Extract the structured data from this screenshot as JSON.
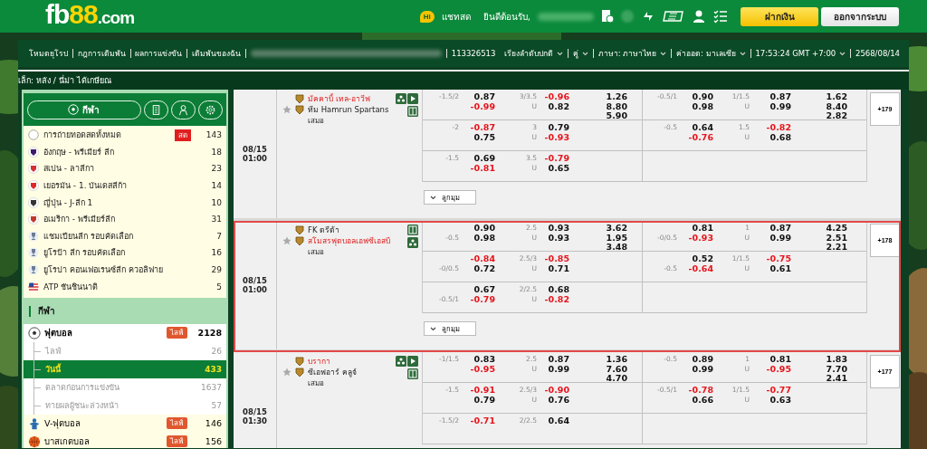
{
  "header": {
    "logo": {
      "main": "fb",
      "accent": "88",
      "suffix": ".com"
    },
    "chat_badge": "Hi",
    "chat_label": "แชทสด",
    "welcome": "ยินดีต้อนรับ,",
    "deposit_button": "ฝากเงิน",
    "logout_button": "ออกจากระบบ"
  },
  "nav": {
    "links": [
      "โหมดยุโรป",
      "กฎการเดิมพัน",
      "ผลการแข่งขัน",
      "เดิมพันของฉัน"
    ],
    "account_id": "113326513",
    "dropdowns": [
      "เรียงลำดับปกติ",
      "คู่",
      "ภาษา: ภาษาไทย",
      "ค่าออด: มาเลเซีย",
      "17:53:24 GMT +7:00"
    ],
    "date": "2568/08/14"
  },
  "breadcrumb": "เล็ก: หลัง / นี่ม่า ได้เกษียณ",
  "sidebar": {
    "sports_button": "กีฬา",
    "leagues": [
      {
        "kind": "all",
        "name": "การถ่ายทอดสดทั้งหมด",
        "badge": "สด",
        "count": "143"
      },
      {
        "kind": "crest",
        "color": "#3d1a6e",
        "name": "อังกฤษ - พรีเมียร์ ลีก",
        "count": "18"
      },
      {
        "kind": "crest",
        "color": "#d63030",
        "name": "สเปน - ลาลีกา",
        "count": "23"
      },
      {
        "kind": "crest",
        "color": "#e02828",
        "name": "เยอรมัน - 1. บันเดสลีก้า",
        "count": "14"
      },
      {
        "kind": "crest",
        "color": "#333333",
        "name": "ญี่ปุ่น - J-ลีก 1",
        "count": "10"
      },
      {
        "kind": "crest",
        "color": "#c0392b",
        "name": "อเมริกา - พรีเมียร์ลีก",
        "count": "31"
      },
      {
        "kind": "trophy",
        "name": "แชมเปียนลีก รอบคัดเลือก",
        "count": "7"
      },
      {
        "kind": "trophy",
        "name": "ยูโรป้า ลีก รอบคัดเลือก",
        "count": "16"
      },
      {
        "kind": "trophy",
        "name": "ยูโรปา คอนเฟอเรนซ์ลีก ควอลิฟาย",
        "count": "29"
      },
      {
        "kind": "flag",
        "name": "ATP ชันชินนาติ",
        "count": "5"
      }
    ],
    "section_title": "กีฬา",
    "sports": [
      {
        "kind": "football",
        "name": "ฟุตบอล",
        "badge": "ไลฟ์",
        "count": "2128",
        "expanded": true,
        "children": [
          {
            "name": "ไลฟ์",
            "count": "26",
            "selected": false
          },
          {
            "name": "วันนี้",
            "count": "433",
            "selected": true
          },
          {
            "name": "ตลาดก่อนการแข่งขัน",
            "count": "1637",
            "selected": false
          },
          {
            "name": "ทายผลผู้ชนะล่วงหน้า",
            "count": "57",
            "selected": false
          }
        ]
      },
      {
        "kind": "virtual",
        "name": "V-ฟุตบอล",
        "badge": "ไลฟ์",
        "count": "146",
        "expanded": false
      },
      {
        "kind": "basketball",
        "name": "บาสเกตบอล",
        "badge": "ไลฟ์",
        "count": "156",
        "expanded": false
      }
    ]
  },
  "matches": [
    {
      "date": "08/15",
      "time": "01:00",
      "home": "มัคคาบี้ เทล-อาวีฟ",
      "away": "ทีม Hamrun Spartans",
      "draw": "เสมอ",
      "home_favorite": true,
      "highlighted": false,
      "icon_rows": [
        [
          {
            "kind": "stats"
          },
          {
            "kind": "play"
          }
        ],
        [
          {
            "kind": "field"
          }
        ]
      ],
      "more": "+179",
      "corners_button": "ลูกมุม",
      "lines": [
        {
          "ft": {
            "hdp": "-1.5/2",
            "hdp_prices": [
              {
                "v": "0.87",
                "negative": false
              },
              {
                "v": "-0.99",
                "negative": true
              }
            ],
            "ou": "3/3.5",
            "ou_under": "U",
            "ou_prices": [
              {
                "v": "-0.96",
                "negative": true
              },
              {
                "v": "0.82",
                "negative": false
              }
            ],
            "x12": [
              "1.26",
              "8.80",
              "5.90"
            ]
          },
          "ht": {
            "hdp": "-0.5/1",
            "hdp_prices": [
              {
                "v": "0.90",
                "negative": false
              },
              {
                "v": "0.98",
                "negative": false
              }
            ],
            "ou": "1/1.5",
            "ou_under": "U",
            "ou_prices": [
              {
                "v": "0.87",
                "negative": false
              },
              {
                "v": "0.99",
                "negative": false
              }
            ],
            "x12": [
              "1.62",
              "8.40",
              "2.82"
            ]
          }
        },
        {
          "ft": {
            "hdp": "-2",
            "hdp_prices": [
              {
                "v": "-0.87",
                "negative": true
              },
              {
                "v": "0.75",
                "negative": false
              }
            ],
            "ou": "3",
            "ou_under": "U",
            "ou_prices": [
              {
                "v": "0.79",
                "negative": false
              },
              {
                "v": "-0.93",
                "negative": true
              }
            ]
          },
          "ht": {
            "hdp": "-0.5",
            "hdp_prices": [
              {
                "v": "0.64",
                "negative": false
              },
              {
                "v": "-0.76",
                "negative": true
              }
            ],
            "ou": "1.5",
            "ou_under": "U",
            "ou_prices": [
              {
                "v": "-0.82",
                "negative": true
              },
              {
                "v": "0.68",
                "negative": false
              }
            ]
          }
        },
        {
          "ft": {
            "hdp": "-1.5",
            "hdp_prices": [
              {
                "v": "0.69",
                "negative": false
              },
              {
                "v": "-0.81",
                "negative": true
              }
            ],
            "ou": "3.5",
            "ou_under": "U",
            "ou_prices": [
              {
                "v": "-0.79",
                "negative": true
              },
              {
                "v": "0.65",
                "negative": false
              }
            ]
          }
        }
      ]
    },
    {
      "date": "08/15",
      "time": "01:00",
      "home": "FK ตรีต้า",
      "away": "สโมสรฟุตบอลเอฟซีเอสบี",
      "draw": "เสมอ",
      "home_favorite": false,
      "highlighted": true,
      "icon_rows": [
        [
          {
            "kind": "field"
          }
        ],
        [
          {
            "kind": "stats"
          }
        ]
      ],
      "more": "+178",
      "corners_button": "ลูกมุม",
      "lines": [
        {
          "ft": {
            "hdp": "-0.5",
            "hdp_prices": [
              {
                "v": "0.90",
                "negative": false
              },
              {
                "v": "0.98",
                "negative": false
              }
            ],
            "ou": "2.5",
            "ou_under": "U",
            "ou_prices": [
              {
                "v": "0.93",
                "negative": false
              },
              {
                "v": "0.93",
                "negative": false
              }
            ],
            "x12": [
              "3.62",
              "1.95",
              "3.48"
            ]
          },
          "ht": {
            "hdp": "-0/0.5",
            "hdp_prices": [
              {
                "v": "0.81",
                "negative": false
              },
              {
                "v": "-0.93",
                "negative": true
              }
            ],
            "ou": "1",
            "ou_under": "U",
            "ou_prices": [
              {
                "v": "0.87",
                "negative": false
              },
              {
                "v": "0.99",
                "negative": false
              }
            ],
            "x12": [
              "4.25",
              "2.51",
              "2.21"
            ]
          }
        },
        {
          "ft": {
            "hdp": "-0/0.5",
            "hdp_prices": [
              {
                "v": "-0.84",
                "negative": true
              },
              {
                "v": "0.72",
                "negative": false
              }
            ],
            "ou": "2.5/3",
            "ou_under": "U",
            "ou_prices": [
              {
                "v": "-0.85",
                "negative": true
              },
              {
                "v": "0.71",
                "negative": false
              }
            ]
          },
          "ht": {
            "hdp": "-0.5",
            "hdp_prices": [
              {
                "v": "0.52",
                "negative": false
              },
              {
                "v": "-0.64",
                "negative": true
              }
            ],
            "ou": "1/1.5",
            "ou_under": "U",
            "ou_prices": [
              {
                "v": "-0.75",
                "negative": true
              },
              {
                "v": "0.61",
                "negative": false
              }
            ]
          }
        },
        {
          "ft": {
            "hdp": "-0.5/1",
            "hdp_prices": [
              {
                "v": "0.67",
                "negative": false
              },
              {
                "v": "-0.79",
                "negative": true
              }
            ],
            "ou": "2/2.5",
            "ou_under": "U",
            "ou_prices": [
              {
                "v": "0.68",
                "negative": false
              },
              {
                "v": "-0.82",
                "negative": true
              }
            ]
          }
        }
      ]
    },
    {
      "date": "08/15",
      "time": "01:30",
      "home": "บรากา",
      "away": "ซีเอฟอาร์ คลูจ์",
      "draw": "เสมอ",
      "home_favorite": true,
      "highlighted": false,
      "icon_rows": [
        [
          {
            "kind": "stats"
          },
          {
            "kind": "play"
          }
        ],
        [
          {
            "kind": "field"
          }
        ]
      ],
      "more": "+177",
      "lines": [
        {
          "ft": {
            "hdp": "-1/1.5",
            "hdp_prices": [
              {
                "v": "0.83",
                "negative": false
              },
              {
                "v": "-0.95",
                "negative": true
              }
            ],
            "ou": "2.5",
            "ou_under": "U",
            "ou_prices": [
              {
                "v": "0.87",
                "negative": false
              },
              {
                "v": "0.99",
                "negative": false
              }
            ],
            "x12": [
              "1.36",
              "7.60",
              "4.70"
            ]
          },
          "ht": {
            "hdp": "-0.5",
            "hdp_prices": [
              {
                "v": "0.89",
                "negative": false
              },
              {
                "v": "0.99",
                "negative": false
              }
            ],
            "ou": "1",
            "ou_under": "U",
            "ou_prices": [
              {
                "v": "0.81",
                "negative": false
              },
              {
                "v": "-0.95",
                "negative": true
              }
            ],
            "x12": [
              "1.83",
              "7.70",
              "2.41"
            ]
          }
        },
        {
          "ft": {
            "hdp": "-1.5",
            "hdp_prices": [
              {
                "v": "-0.91",
                "negative": true
              },
              {
                "v": "0.79",
                "negative": false
              }
            ],
            "ou": "2.5/3",
            "ou_under": "U",
            "ou_prices": [
              {
                "v": "-0.90",
                "negative": true
              },
              {
                "v": "0.76",
                "negative": false
              }
            ]
          },
          "ht": {
            "hdp": "-0.5/1",
            "hdp_prices": [
              {
                "v": "-0.78",
                "negative": true
              },
              {
                "v": "0.66",
                "negative": false
              }
            ],
            "ou": "1/1.5",
            "ou_under": "U",
            "ou_prices": [
              {
                "v": "-0.77",
                "negative": true
              },
              {
                "v": "0.63",
                "negative": false
              }
            ]
          }
        },
        {
          "ft": {
            "hdp": "-1.5/2",
            "hdp_prices": [
              {
                "v": "-0.71",
                "negative": true
              }
            ],
            "ou": "2/2.5",
            "ou_prices": [
              {
                "v": "0.64",
                "negative": false
              }
            ]
          }
        }
      ]
    }
  ]
}
